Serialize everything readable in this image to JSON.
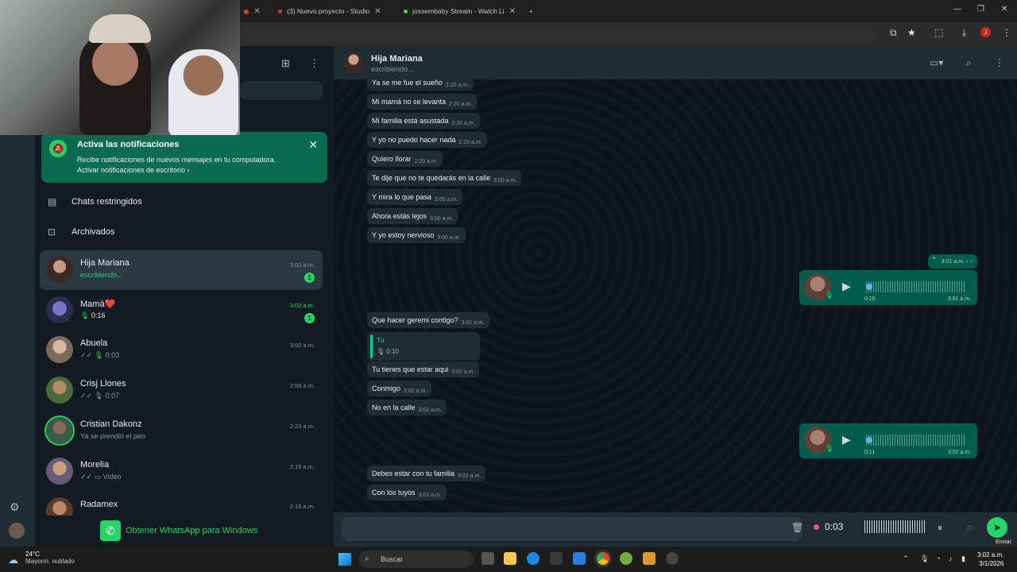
{
  "browser": {
    "tabs": [
      {
        "title": "(3) Nuevo proyecto - Studio"
      },
      {
        "title": "jossembaby Stream - Watch Li"
      }
    ]
  },
  "notification": {
    "title": "Activa las notificaciones",
    "body": "Recibe notificaciones de nuevos mensajes en tu computadora.",
    "link": "Activar notificaciones de escritorio ›"
  },
  "sidebar": {
    "restricted": "Chats restringidos",
    "archived": "Archivados",
    "promo": "Obtener WhatsApp para Windows",
    "chats": [
      {
        "name": "Hija Mariana",
        "sub": "escribiendo...",
        "time": "3:02 a.m.",
        "badge": "1"
      },
      {
        "name": "Mamá❤️",
        "sub": "0:16",
        "time": "3:02 a.m.",
        "badge": "1"
      },
      {
        "name": "Abuela",
        "sub": "0:03",
        "time": "3:02 a.m."
      },
      {
        "name": "Crisj Llones",
        "sub": "0:07",
        "time": "2:59 a.m."
      },
      {
        "name": "Cristian Dakonz",
        "sub": "Ya se prendió el peo",
        "time": "2:23 a.m."
      },
      {
        "name": "Morelia",
        "sub": "Video",
        "time": "2:19 a.m."
      },
      {
        "name": "Radamex",
        "sub": "",
        "time": "2:19 a.m."
      }
    ]
  },
  "chat": {
    "contact_name": "Hija Mariana",
    "contact_status": "escribiendo...",
    "incoming_top": [
      {
        "text": "Ya se me fue el sueño",
        "time": "2:20 a.m."
      },
      {
        "text": "Mi mamá no se levanta",
        "time": "2:20 a.m."
      },
      {
        "text": "Mi familia está asustada",
        "time": "2:20 a.m."
      },
      {
        "text": "Y yo no puedo hacer nada",
        "time": "2:20 a.m."
      },
      {
        "text": "Quiero llorar",
        "time": "2:20 a.m."
      },
      {
        "text": "Te dije que no te quedarás en la calle",
        "time": "3:00 a.m."
      },
      {
        "text": "Y mira lo que pasa",
        "time": "3:00 a.m."
      },
      {
        "text": "Ahora estás lejos",
        "time": "3:00 a.m."
      },
      {
        "text": "Y yo estoy nervioso",
        "time": "3:00 a.m."
      }
    ],
    "out_small": {
      "text": "*",
      "time": "3:01 a.m."
    },
    "voice1": {
      "duration": "0:10",
      "time": "3:01 a.m."
    },
    "incoming_mid": [
      {
        "text": "Que hacer geremi contigo?",
        "time": "3:02 a.m."
      }
    ],
    "quote": {
      "who": "Tú",
      "length": "0:10"
    },
    "incoming_after_quote": [
      {
        "text": "Tu tienes que estar aqui",
        "time": "3:02 a.m."
      },
      {
        "text": "Conmigo",
        "time": "3:02 a.m."
      },
      {
        "text": "No en la calle",
        "time": "3:02 a.m."
      }
    ],
    "voice2": {
      "duration": "0:11",
      "time": "3:02 a.m."
    },
    "incoming_bottom": [
      {
        "text": "Debes estar con tu familia",
        "time": "3:02 a.m."
      },
      {
        "text": "Con los tuyos",
        "time": "3:02 a.m."
      }
    ]
  },
  "composer": {
    "recording_time": "0:03",
    "send_tooltip": "Enviar"
  },
  "taskbar": {
    "weather_temp": "24°C",
    "weather_desc": "Mayorm. nublado",
    "search": "Buscar",
    "time": "3:02 a.m.",
    "date": "3/1/2026"
  }
}
